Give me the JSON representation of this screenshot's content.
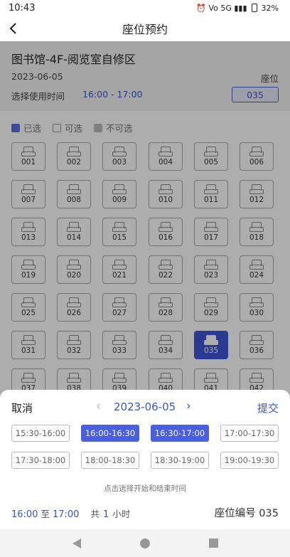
{
  "status": {
    "time": "10:43",
    "indicators": "⏰ Vo 5G ▮▮▮",
    "battery": "32%"
  },
  "header": {
    "title": "座位预约"
  },
  "info": {
    "venue": "图书馆-4F-阅览室自修区",
    "date": "2023-06-05",
    "seat_label": "座位",
    "time_label": "选择使用时间",
    "time_value": "16:00 - 17:00",
    "seat_value": "035"
  },
  "legend": {
    "selected": "已选",
    "available": "可选",
    "unavailable": "不可选"
  },
  "seats": [
    "001",
    "002",
    "003",
    "004",
    "005",
    "006",
    "007",
    "008",
    "009",
    "010",
    "011",
    "012",
    "013",
    "014",
    "015",
    "016",
    "017",
    "018",
    "019",
    "020",
    "021",
    "022",
    "023",
    "024",
    "025",
    "026",
    "027",
    "028",
    "029",
    "030",
    "031",
    "032",
    "033",
    "034",
    "035",
    "036",
    "037",
    "038",
    "039",
    "040",
    "041",
    "042"
  ],
  "selected_seat": "035",
  "sheet": {
    "cancel": "取消",
    "submit": "提交",
    "date": "2023-06-05",
    "prev_icon": "‹",
    "next_icon": "›",
    "slots": [
      {
        "label": "15:30-16:00",
        "on": false
      },
      {
        "label": "16:00-16:30",
        "on": true
      },
      {
        "label": "16:30-17:00",
        "on": true
      },
      {
        "label": "17:00-17:30",
        "on": false
      },
      {
        "label": "17:30-18:00",
        "on": false
      },
      {
        "label": "18:00-18:30",
        "on": false
      },
      {
        "label": "18:30-19:00",
        "on": false
      },
      {
        "label": "19:00-19:30",
        "on": false
      }
    ],
    "hint": "点击选择开始和结束时间",
    "summary": {
      "start": "16:00",
      "to": "至",
      "end": "17:00",
      "total_prefix": "共",
      "hours": "1",
      "unit": "小时"
    },
    "seat_number": "座位编号 035"
  }
}
